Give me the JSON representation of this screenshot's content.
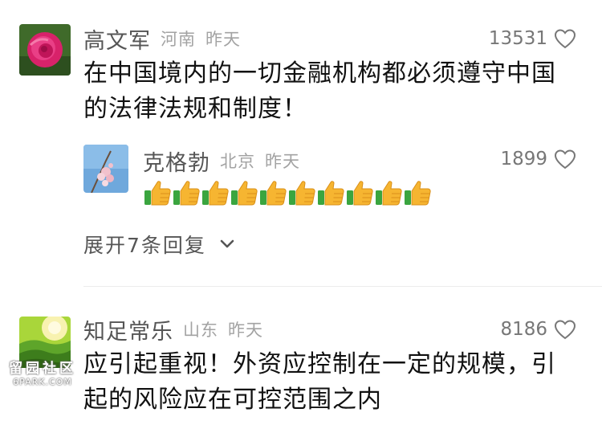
{
  "comments": [
    {
      "name": "高文军",
      "location": "河南",
      "time": "昨天",
      "likes": "13531",
      "text_lines": [
        "在中国境内的一切金融机构都必须遵守中国",
        "的法律法规和制度！"
      ],
      "avatar": "rose-avatar"
    },
    {
      "name": "知足常乐",
      "location": "山东",
      "time": "昨天",
      "likes": "8186",
      "text_lines": [
        "应引起重视！外资应控制在一定的规模，引",
        "起的风险应在可控范围之内"
      ],
      "avatar": "tea-field-avatar"
    }
  ],
  "reply": {
    "name": "克格勃",
    "location": "北京",
    "time": "昨天",
    "likes": "1899",
    "thumbs_up_count": 10,
    "avatar": "peach-blossom-avatar"
  },
  "expand_replies": {
    "label": "展开7条回复",
    "icon": "chevron-down-icon"
  },
  "watermark": {
    "line1": "留园社区",
    "line2": "6PARK.COM"
  },
  "colors": {
    "name": "#555555",
    "meta": "#a3a3a3",
    "body": "#111111",
    "thumb": "#f6b531"
  }
}
